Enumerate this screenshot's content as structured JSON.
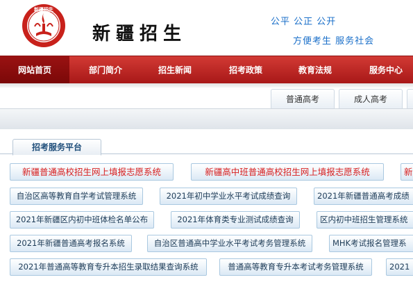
{
  "header": {
    "logo_text": "新疆招生",
    "title": "新疆招生",
    "slogan_line1": "公平 公正 公开",
    "slogan_line2": "方便考生 服务社会"
  },
  "colors": {
    "brand_red": "#b01e1e",
    "link_blue": "#1a6fc9",
    "button_border": "#a9c8e0"
  },
  "nav": {
    "items": [
      {
        "label": "网站首页",
        "active": true
      },
      {
        "label": "部门简介"
      },
      {
        "label": "招生新闻"
      },
      {
        "label": "招考政策"
      },
      {
        "label": "教育法规"
      },
      {
        "label": "服务中心"
      }
    ]
  },
  "subtabs": [
    {
      "label": "普通高考"
    },
    {
      "label": "成人高考"
    }
  ],
  "platform": {
    "title": "招考服务平台",
    "rows": [
      [
        "新疆普通高校招生网上填报志愿系统",
        "新疆高中班普通高校招生网上填报志愿系统",
        "新"
      ],
      [
        "自治区高等教育自学考试管理系统",
        "2021年初中学业水平考试成绩查询",
        "2021年新疆普通高考成绩"
      ],
      [
        "2021年新疆区内初中班体检名单公布",
        "2021年体育类专业测试成绩查询",
        "区内初中班招生管理系统"
      ],
      [
        "2021年新疆普通高考报名系统",
        "自治区普通高中学业水平考试考务管理系统",
        "MHK考试报名管理系"
      ],
      [
        "2021年普通高等教育专升本招生录取结果查询系统",
        "普通高等教育专升本考试考务管理系统",
        "2021"
      ]
    ]
  }
}
